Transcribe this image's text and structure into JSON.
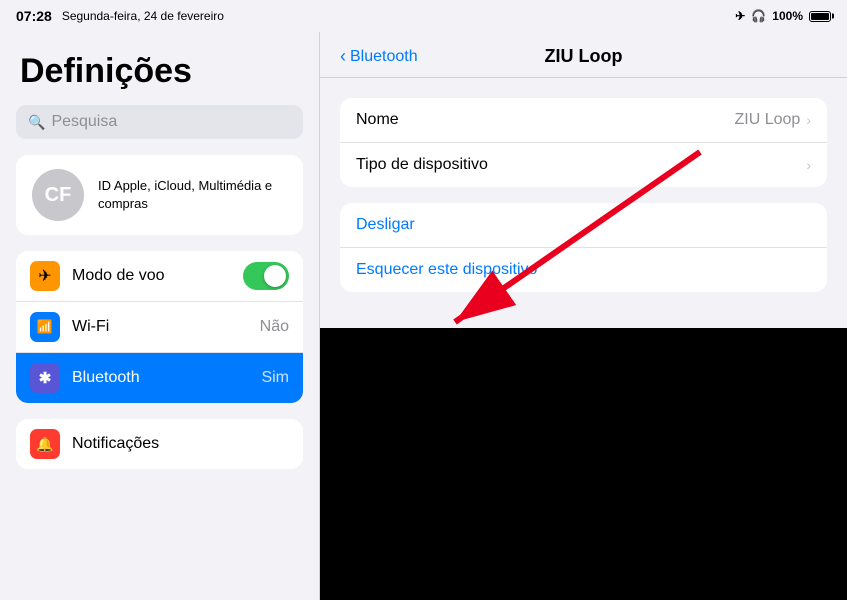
{
  "statusBar": {
    "time": "07:28",
    "date": "Segunda-feira, 24 de fevereiro",
    "airplane": "✈",
    "headphones": "🎧",
    "battery": "100%"
  },
  "leftPanel": {
    "title": "Definições",
    "searchPlaceholder": "Pesquisa",
    "profile": {
      "initials": "CF",
      "description": "ID Apple, iCloud, Multimédia\ne compras"
    },
    "rows": [
      {
        "icon": "✈",
        "iconClass": "icon-orange",
        "label": "Modo de voo",
        "value": "",
        "hasToggle": true,
        "active": false
      },
      {
        "icon": "📶",
        "iconClass": "icon-blue",
        "label": "Wi-Fi",
        "value": "Não",
        "hasToggle": false,
        "active": false
      },
      {
        "icon": "✱",
        "iconClass": "icon-blue2",
        "label": "Bluetooth",
        "value": "Sim",
        "hasToggle": false,
        "active": true
      }
    ],
    "rows2": [
      {
        "icon": "🔔",
        "iconClass": "icon-red",
        "label": "Notificações",
        "value": "",
        "active": false
      }
    ]
  },
  "rightPanel": {
    "backLabel": "Bluetooth",
    "title": "ZIU Loop",
    "groups": [
      {
        "rows": [
          {
            "label": "Nome",
            "value": "ZIU Loop",
            "hasChevron": true
          },
          {
            "label": "Tipo de dispositivo",
            "value": "",
            "hasChevron": true
          }
        ]
      }
    ],
    "actions": [
      {
        "label": "Desligar",
        "isBlue": true
      },
      {
        "label": "Esquecer este dispositivo",
        "isBlue": true
      }
    ]
  }
}
